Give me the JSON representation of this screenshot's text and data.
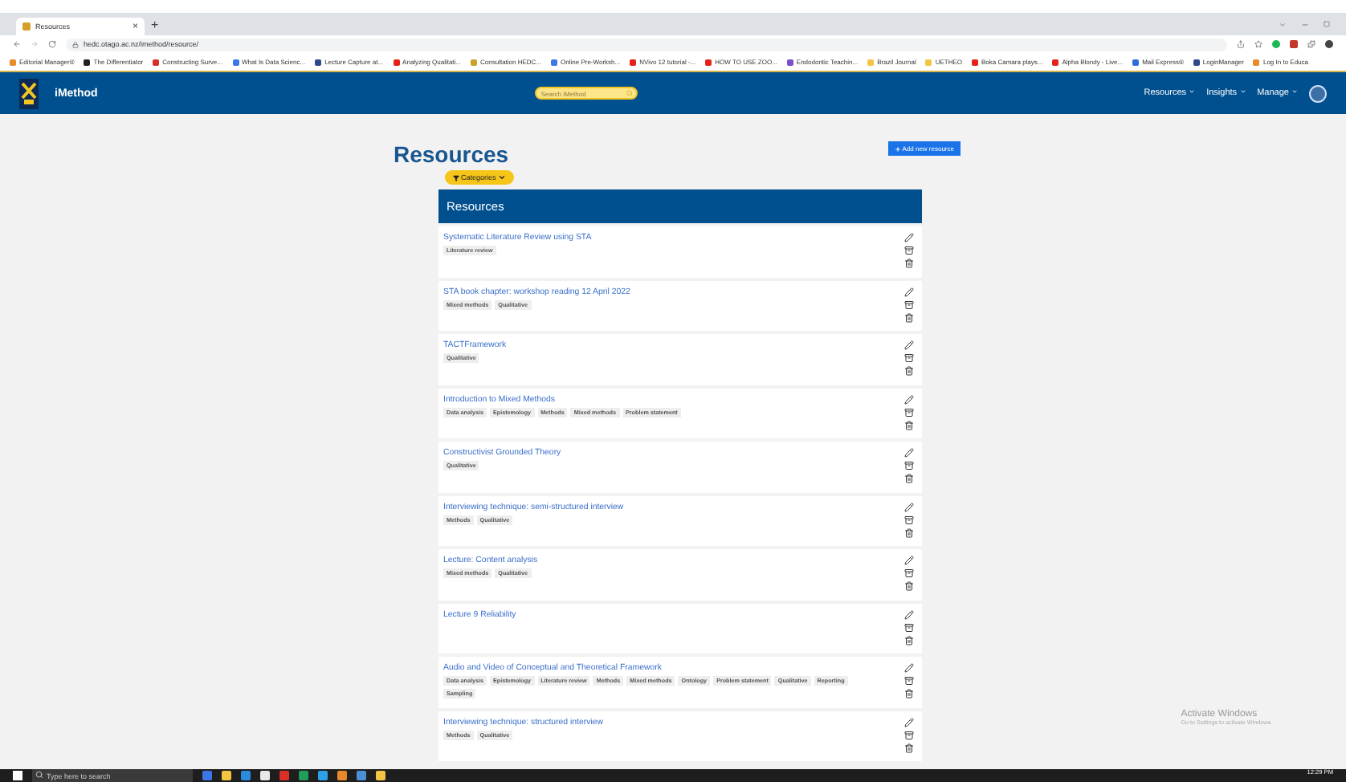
{
  "browser": {
    "tab": {
      "title": "Resources",
      "close": "×"
    },
    "new_tab": "+",
    "url": "hedc.otago.ac.nz/imethod/resource/",
    "bookmarks": [
      {
        "label": "Editorial Manager®",
        "color": "#e8892b"
      },
      {
        "label": "The Differentiator",
        "color": "#222222"
      },
      {
        "label": "Constructing Surve...",
        "color": "#d93025"
      },
      {
        "label": "What Is Data Scienc...",
        "color": "#3b78e7"
      },
      {
        "label": "Lecture Capture at...",
        "color": "#2f4a8a"
      },
      {
        "label": "Analyzing Qualitati...",
        "color": "#e62117"
      },
      {
        "label": "Consultation HEDC...",
        "color": "#c9a227"
      },
      {
        "label": "Online Pre-Worksh...",
        "color": "#3b78e7"
      },
      {
        "label": "NVivo 12 tutorial -...",
        "color": "#e62117"
      },
      {
        "label": "HOW TO USE ZOO...",
        "color": "#e62117"
      },
      {
        "label": "Endodontic Teachin...",
        "color": "#7b4fc9"
      },
      {
        "label": "Brazil Journal",
        "color": "#f4c542"
      },
      {
        "label": "UETHEO",
        "color": "#f4c542"
      },
      {
        "label": "Boka Camara plays...",
        "color": "#e62117"
      },
      {
        "label": "Alpha Blondy - Live...",
        "color": "#e62117"
      },
      {
        "label": "Mail Express®",
        "color": "#2a6fd6"
      },
      {
        "label": "LoginManager",
        "color": "#2f4a8a"
      },
      {
        "label": "Log In to Educa",
        "color": "#e8892b"
      }
    ]
  },
  "navbar": {
    "brand": "iMethod",
    "search": {
      "placeholder": "Search iMethod"
    },
    "menus": [
      "Resources",
      "Insights",
      "Manage"
    ]
  },
  "page": {
    "title": "Resources",
    "add_button": "Add new resource",
    "filter_button": "Categories",
    "panel_title": "Resources",
    "resources": [
      {
        "title": "Systematic Literature Review using STA",
        "tags": [
          "Literature review"
        ]
      },
      {
        "title": "STA book chapter: workshop reading 12 April 2022",
        "tags": [
          "Mixed methods",
          "Qualitative"
        ]
      },
      {
        "title": "TACTFramework",
        "tags": [
          "Qualitative"
        ]
      },
      {
        "title": "Introduction to Mixed Methods",
        "tags": [
          "Data analysis",
          "Epistemology",
          "Methods",
          "Mixed methods",
          "Problem statement"
        ]
      },
      {
        "title": "Constructivist Grounded Theory",
        "tags": [
          "Qualitative"
        ]
      },
      {
        "title": "Interviewing technique: semi-structured interview",
        "tags": [
          "Methods",
          "Qualitative"
        ]
      },
      {
        "title": "Lecture: Content analysis",
        "tags": [
          "Mixed methods",
          "Qualitative"
        ]
      },
      {
        "title": "Lecture 9 Reliability"
      },
      {
        "title": "Audio and Video of Conceptual and Theoretical Framework",
        "tags": [
          "Data analysis",
          "Epistemology",
          "Literature review",
          "Methods",
          "Mixed methods",
          "Ontology",
          "Problem statement",
          "Qualitative",
          "Reporting",
          "Sampling"
        ]
      },
      {
        "title": "Interviewing technique: structured interview",
        "tags": [
          "Methods",
          "Qualitative"
        ]
      }
    ]
  },
  "os": {
    "activation": {
      "title": "Activate Windows",
      "hint": "Go to Settings to activate Windows."
    },
    "taskbar": {
      "search_placeholder": "Type here to search",
      "time": "12:29 PM"
    }
  }
}
